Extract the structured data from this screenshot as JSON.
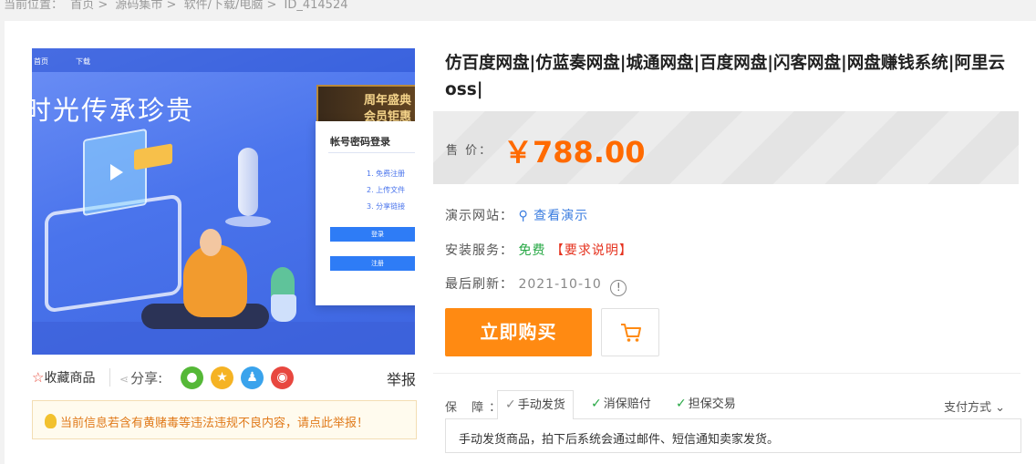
{
  "breadcrumb": {
    "prefix": "当前位置：",
    "items": [
      "首页",
      "源码集市",
      "软件/下载/电脑",
      "ID_414524"
    ],
    "separator": ">"
  },
  "product_image": {
    "nav_items": [
      "首页",
      "下载"
    ],
    "slogan": "时光传承珍贵",
    "banner_lines": [
      "周年盛典",
      "会员钜惠"
    ],
    "login_title": "帐号密码登录",
    "login_items": [
      "1. 免费注册",
      "2. 上传文件",
      "3. 分享链接"
    ],
    "login_buttons": [
      "登录",
      "注册"
    ]
  },
  "actions": {
    "favorite_label": "收藏商品",
    "share_label": "分享:",
    "report_label": "举报",
    "share_icons": [
      "wechat-icon",
      "qzone-icon",
      "qq-icon",
      "weibo-icon"
    ]
  },
  "notice": {
    "text": "当前信息若含有黄赌毒等违法违规不良内容，请点此举报！"
  },
  "product": {
    "title": "仿百度网盘|仿蓝奏网盘|城通网盘|百度网盘|闪客网盘|网盘赚钱系统|阿里云oss|",
    "price_label": "售  价：",
    "price": "￥788.00"
  },
  "details": {
    "demo_label": "演示网站：",
    "demo_link": "查看演示",
    "install_label": "安装服务：",
    "install_value": "免费",
    "install_note": "【要求说明】",
    "refresh_label": "最后刷新：",
    "refresh_value": "2021-10-10"
  },
  "buttons": {
    "buy_now": "立即购买"
  },
  "guarantee": {
    "label": "保  障：",
    "tabs": [
      "手动发货",
      "消保赔付",
      "担保交易"
    ],
    "active_tab": "手动发货",
    "payment_label": "支付方式",
    "description": "手动发货商品，拍下后系统会通过邮件、短信通知卖家发货。"
  },
  "colors": {
    "accent": "#ff8a12",
    "price": "#ff6a00",
    "link": "#3b7de0",
    "free": "#27a845",
    "warning": "#e5321e"
  }
}
